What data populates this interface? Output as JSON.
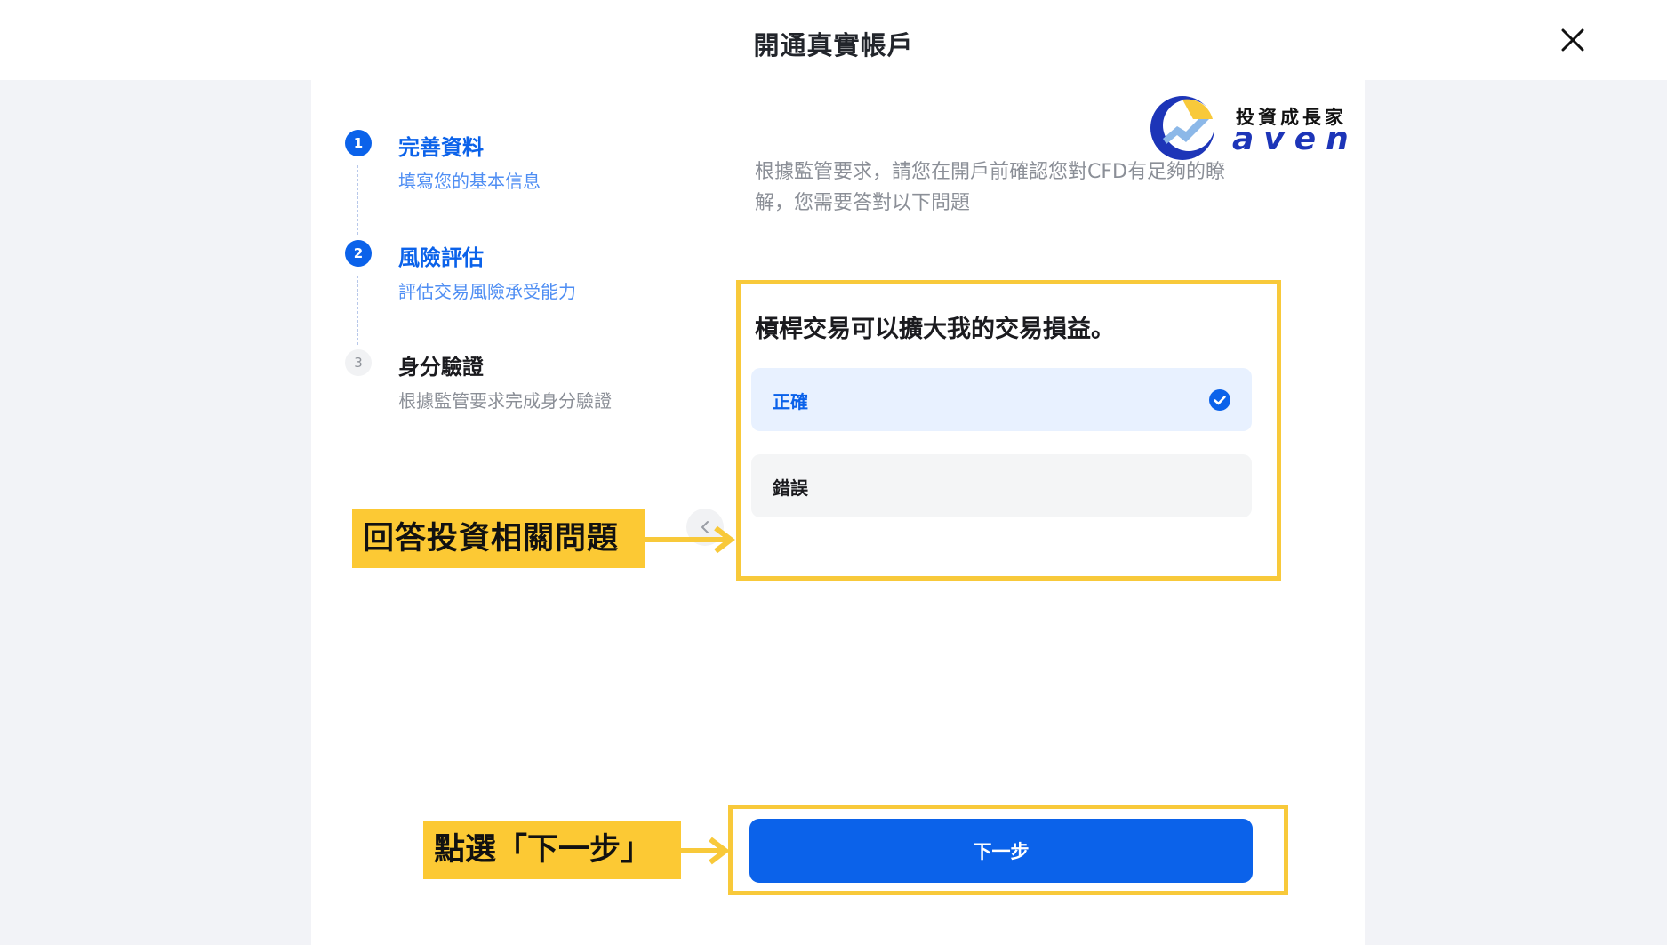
{
  "window": {
    "title": "開通真實帳戶"
  },
  "steps": [
    {
      "number": "1",
      "title": "完善資料",
      "description": "填寫您的基本信息",
      "state": "completed"
    },
    {
      "number": "2",
      "title": "風險評估",
      "description": "評估交易風險承受能力",
      "state": "current"
    },
    {
      "number": "3",
      "title": "身分驗證",
      "description": "根據監管要求完成身分驗證",
      "state": "pending"
    }
  ],
  "logo": {
    "chinese_text": "投資成長家",
    "english_text": "aven"
  },
  "content": {
    "intro": "根據監管要求，請您在開戶前確認您對CFD有足夠的瞭解，您需要答對以下問題",
    "question": "槓桿交易可以擴大我的交易損益。",
    "options": [
      {
        "label": "正確",
        "selected": true
      },
      {
        "label": "錯誤",
        "selected": false
      }
    ],
    "next_button": "下一步"
  },
  "annotations": {
    "answer_label": "回答投資相關問題",
    "next_label": "點選「下一步」",
    "highlight_color": "#f8c93a"
  },
  "colors": {
    "accent": "#0b62ea",
    "selected_option_bg": "#e8f1ff",
    "option_bg": "#f4f5f6",
    "page_bg": "#f2f3f7"
  },
  "icons": {
    "close": "close-icon",
    "check": "check-circle-icon",
    "collapse": "chevron-left-icon"
  }
}
